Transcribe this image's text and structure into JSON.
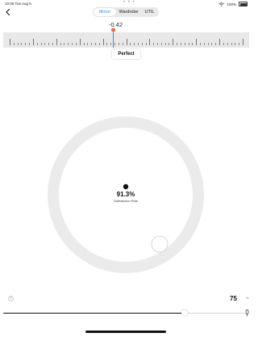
{
  "status_bar": {
    "time": "10:05",
    "date": "Tue Aug 6",
    "dots": "• • •",
    "battery": "100%"
  },
  "segmented": {
    "options": [
      "Mirror",
      "Wardrobe",
      "UTIL"
    ],
    "selected": "Mirror"
  },
  "ruler": {
    "value": "-0.42",
    "status": "Perfect"
  },
  "gauge": {
    "satisfaction": "91.3%",
    "label": "Satisfaction Rate"
  },
  "level": {
    "value": "75",
    "unit": "%",
    "fraction": 0.75
  },
  "colors": {
    "accent": "#2b8ef0",
    "needle": "#f26b3a",
    "ring": "#ebebeb"
  },
  "icons": [
    "back-chevron-icon",
    "wifi-icon",
    "battery-icon",
    "help-icon",
    "slider-end-icon"
  ]
}
